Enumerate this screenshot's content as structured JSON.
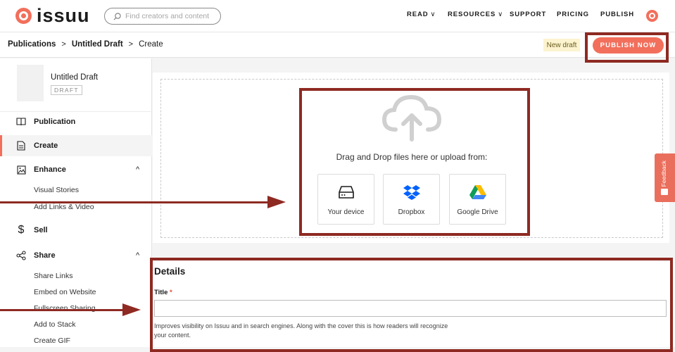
{
  "header": {
    "logo_text": "issuu",
    "search_placeholder": "Find creators and content",
    "nav": [
      {
        "label": "READ",
        "chevron": "∨"
      },
      {
        "label": "RESOURCES",
        "chevron": "∨"
      },
      {
        "label": "SUPPORT"
      },
      {
        "label": "PRICING"
      },
      {
        "label": "PUBLISH"
      }
    ]
  },
  "breadcrumb": {
    "items": [
      "Publications",
      "Untitled Draft",
      "Create"
    ],
    "separator": ">"
  },
  "subbar": {
    "status_badge": "New draft",
    "publish_label": "PUBLISH NOW"
  },
  "sidebar": {
    "draft_title": "Untitled Draft",
    "draft_badge": "DRAFT",
    "items": [
      {
        "label": "Publication",
        "icon": "book-icon"
      },
      {
        "label": "Create",
        "icon": "document-icon",
        "active": true
      },
      {
        "label": "Enhance",
        "icon": "image-icon",
        "chevron": "^"
      },
      {
        "label": "Sell",
        "icon": "dollar-icon"
      },
      {
        "label": "Share",
        "icon": "share-icon",
        "chevron": "^"
      }
    ],
    "enhance_sub": [
      "Visual Stories",
      "Add Links & Video"
    ],
    "share_sub": [
      "Share Links",
      "Embed on Website",
      "Fullscreen Sharing",
      "Add to Stack",
      "Create GIF"
    ]
  },
  "upload": {
    "drag_text": "Drag and Drop files here or upload from:",
    "sources": [
      {
        "label": "Your device",
        "icon": "hard-drive-icon"
      },
      {
        "label": "Dropbox",
        "icon": "dropbox-icon"
      },
      {
        "label": "Google Drive",
        "icon": "google-drive-icon"
      }
    ]
  },
  "details": {
    "heading": "Details",
    "title_label": "Title",
    "required_mark": "*",
    "title_value": "",
    "help_text": "Improves visibility on Issuu and in search engines. Along with the cover this is how readers will recognize your content."
  },
  "feedback_label": "Feedback",
  "colors": {
    "brand": "#f26f5c",
    "annotation": "#8e2a22",
    "badge_bg": "#fcf3cf",
    "dropbox": "#0061fe"
  }
}
